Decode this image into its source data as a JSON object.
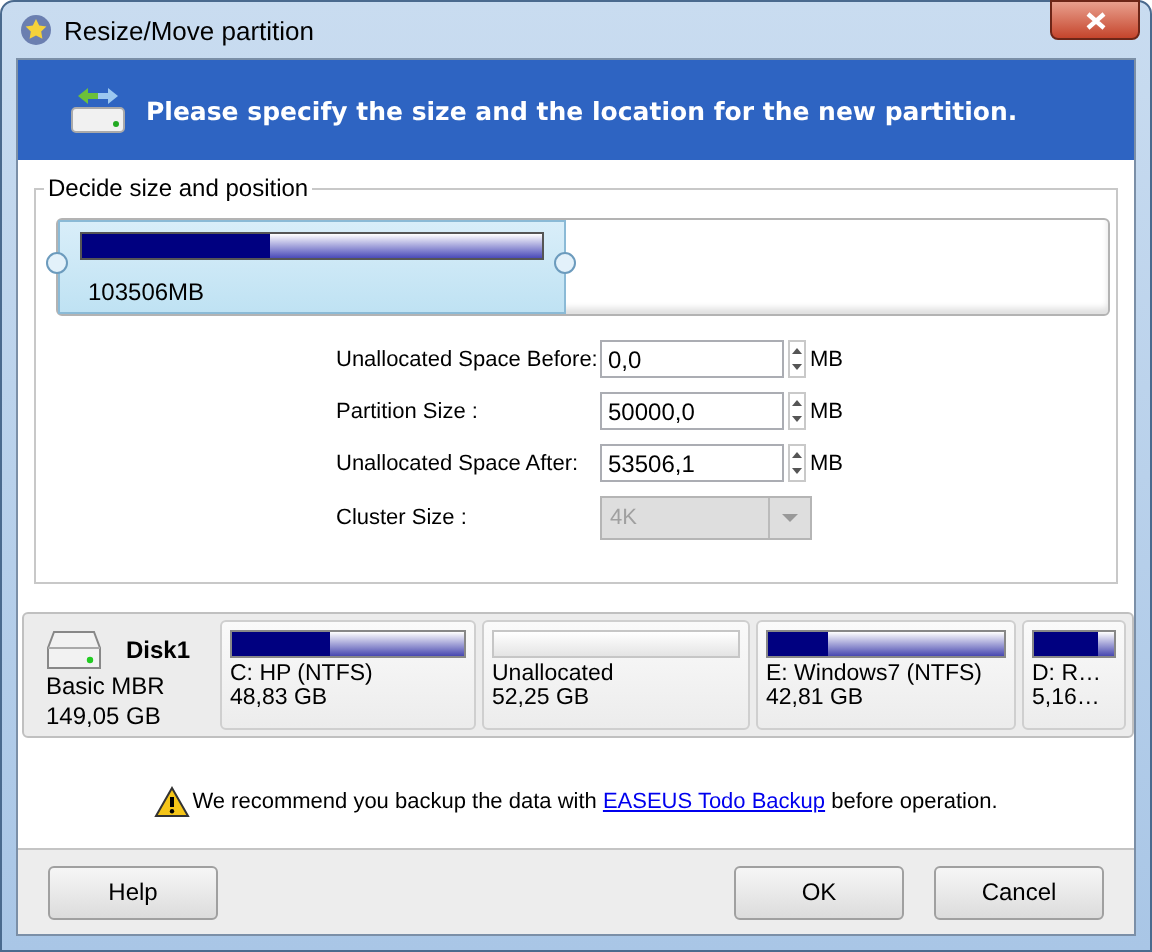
{
  "window": {
    "title": "Resize/Move partition"
  },
  "header": {
    "text": "Please specify the size and the location for the new partition."
  },
  "position_group": {
    "title": "Decide size and position",
    "partition_bar": {
      "usage": {
        "level": 0.41
      },
      "label": "103506MB"
    },
    "fields": [
      {
        "kind": "spin",
        "label": "Unallocated Space Before:",
        "value": "0,0",
        "unit": "MB",
        "disabled": false
      },
      {
        "kind": "spin",
        "label": "Partition Size :",
        "value": "50000,0",
        "unit": "MB",
        "disabled": false
      },
      {
        "kind": "spin",
        "label": "Unallocated Space After:",
        "value": "53506,1",
        "unit": "MB",
        "disabled": false
      },
      {
        "kind": "dropdown",
        "label": "Cluster Size :",
        "value": "4K",
        "disabled": true
      }
    ]
  },
  "disk_map": {
    "disk": {
      "name": "Disk1",
      "type": "Basic MBR",
      "size": "149,05 GB"
    },
    "partitions": [
      {
        "name": "C: HP (NTFS)",
        "size": "48,83 GB",
        "level": 0.42
      },
      {
        "name": "Unallocated",
        "size": "52,25 GB"
      },
      {
        "name": "E: Windows7 (NTFS)",
        "size": "42,81 GB",
        "level": 0.25
      },
      {
        "name": "D: R…",
        "size": "5,16…",
        "level": 0.8
      }
    ]
  },
  "notice": {
    "before": "We recommend you backup the data with",
    "link": "EASEUS Todo Backup",
    "after": "before operation."
  },
  "buttons": [
    {
      "label": "Help"
    },
    {
      "label": "OK"
    },
    {
      "label": "Cancel"
    }
  ]
}
